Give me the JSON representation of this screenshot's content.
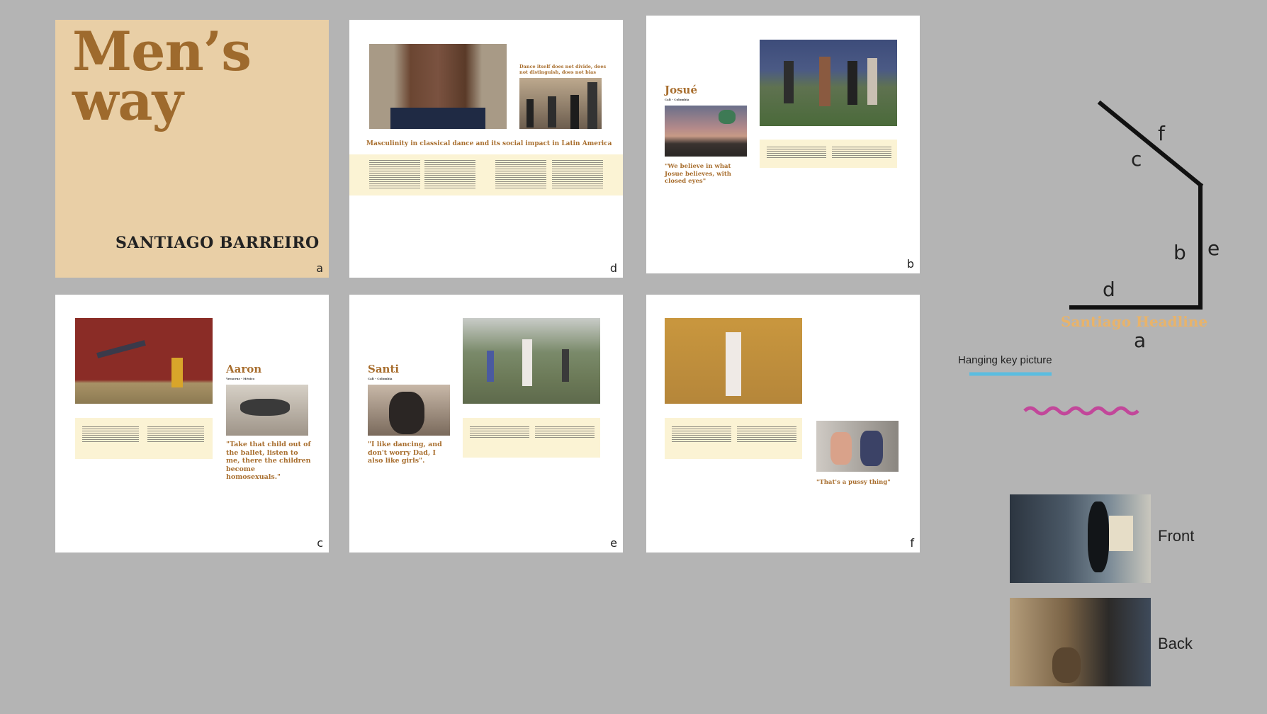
{
  "pages": {
    "a": {
      "letter": "a",
      "title_line1": "Men’s",
      "title_line2": "way",
      "author": "SANTIAGO BARREIRO"
    },
    "d": {
      "letter": "d",
      "pullquote": "Dance itself does not divide, does not distinguish, does not bias",
      "headline": "Masculinity in classical dance and its social impact in Latin America"
    },
    "b": {
      "letter": "b",
      "name": "Josué",
      "place": "Cali - Colombia",
      "quote": "\"We believe in what Josue believes, with closed eyes\""
    },
    "c": {
      "letter": "c",
      "name": "Aaron",
      "place": "Veracruz - México",
      "quote": "\"Take that child out of the ballet, listen to me, there the children become homosexuals.\""
    },
    "e": {
      "letter": "e",
      "name": "Santi",
      "place": "Cali - Colombia",
      "quote": "\"I like dancing, and don't worry Dad, I also like girls\"."
    },
    "f": {
      "letter": "f",
      "quote": "\"That's a pussy thing\""
    }
  },
  "diagram": {
    "labels": {
      "c": "c",
      "f": "f",
      "b": "b",
      "e": "e",
      "d": "d",
      "a": "a"
    },
    "headline_text": "Santiago Headline",
    "hanging_label": "Hanging key picture",
    "colors": {
      "lines": "#111111",
      "headline": "#e8b36a",
      "hanging": "#5bbde0",
      "wave": "#c2479a"
    }
  },
  "thumbnails": {
    "front_label": "Front",
    "back_label": "Back"
  }
}
